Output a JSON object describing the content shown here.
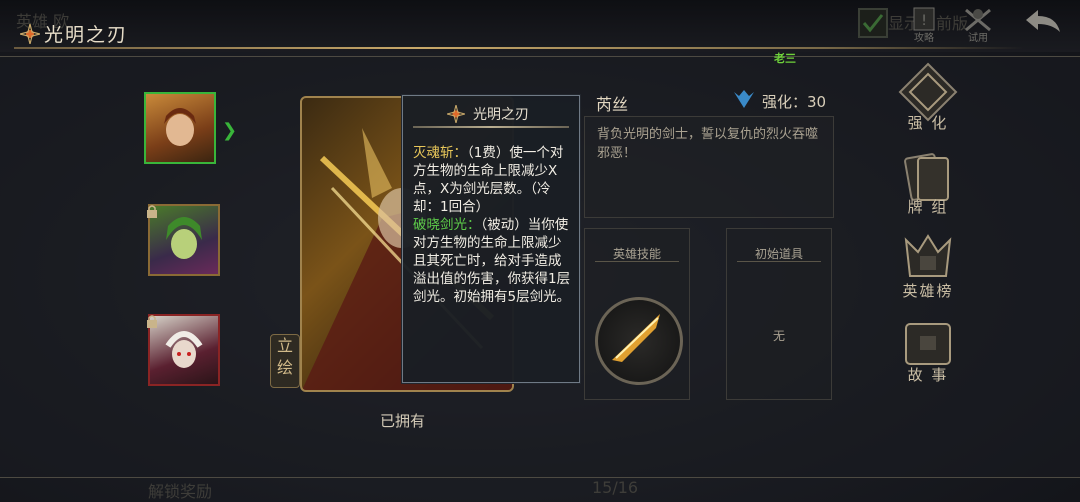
{
  "header": {
    "ghost_text": "英雄  欧",
    "title": "光明之刃",
    "check_label": "显示当前版",
    "guide_label": "攻略",
    "trial_label": "试用"
  },
  "badge": "老三",
  "heroes": [
    {
      "name": "hero-1",
      "locked": false
    },
    {
      "name": "hero-2",
      "locked": true
    },
    {
      "name": "hero-3",
      "locked": true
    }
  ],
  "card": {
    "portrait_button": "立绘",
    "owned_label": "已拥有"
  },
  "tooltip": {
    "title": "光明之刃",
    "skill1_name": "灭魂斩：",
    "skill1_text": "（1费）使一个对方生物的生命上限减少X点，X为剑光层数。（冷却：1回合）",
    "skill2_name": "破晓剑光：",
    "skill2_text": "（被动）当你使对方生物的生命上限减少且其死亡时，给对手造成溢出值的伤害，你获得1层剑光。初始拥有5层剑光。"
  },
  "hero": {
    "name": "芮丝",
    "strength_label": "强化：30",
    "description": "背负光明的剑士，誓以复仇的烈火吞噬邪恶！"
  },
  "panels": {
    "skill_label": "英雄技能",
    "item_label": "初始道具",
    "item_value": "无"
  },
  "right_menu": [
    {
      "label": "强 化",
      "icon": "upgrade-icon"
    },
    {
      "label": "牌 组",
      "icon": "deck-icon"
    },
    {
      "label": "英雄榜",
      "icon": "ranking-icon"
    },
    {
      "label": "故 事",
      "icon": "story-icon"
    }
  ],
  "footer": {
    "left_ghost": "解锁奖励",
    "page": "15/16"
  },
  "colors": {
    "accent_gold": "#c9a96a",
    "selected_green": "#39b53a",
    "skill_yellow": "#e8c75a",
    "passive_green": "#5ecf4a"
  }
}
